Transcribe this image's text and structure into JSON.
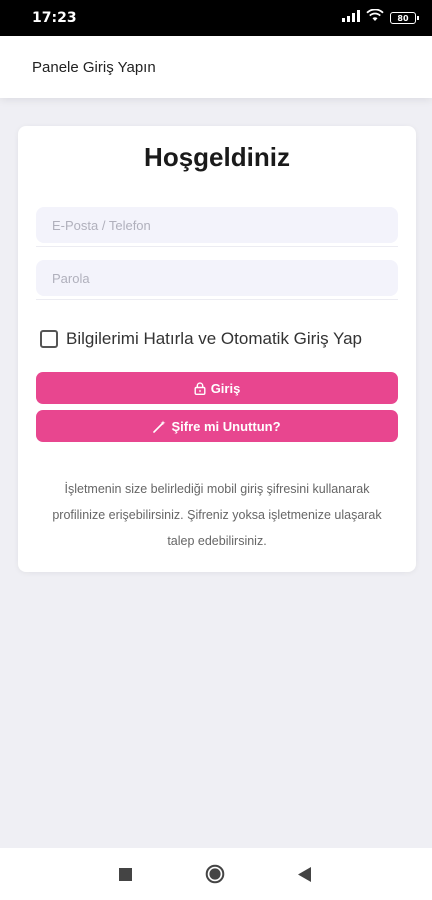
{
  "status_bar": {
    "time": "17:23",
    "battery": "80"
  },
  "app_bar": {
    "title": "Panele Giriş Yapın"
  },
  "login_card": {
    "title": "Hoşgeldiniz",
    "email_placeholder": "E-Posta / Telefon",
    "password_placeholder": "Parola",
    "remember_label": "Bilgilerimi Hatırla ve Otomatik Giriş Yap",
    "remember_checked": false,
    "login_button_label": "Giriş",
    "login_button_icon": "lock-icon",
    "forgot_button_label": "Şifre mi Unuttun?",
    "forgot_button_icon": "magic-wand-icon",
    "info_text": "İşletmenin size belirlediği mobil giriş şifresini kullanarak profilinize erişebilirsiniz. Şifreniz yoksa işletmenize ulaşarak talep edebilirsiniz."
  },
  "nav_bar": {
    "recents_icon": "square-icon",
    "home_icon": "circle-icon",
    "back_icon": "triangle-back-icon"
  },
  "colors": {
    "accent": "#e8468f",
    "background": "#efeff4",
    "input_bg": "#f3f3fb"
  }
}
